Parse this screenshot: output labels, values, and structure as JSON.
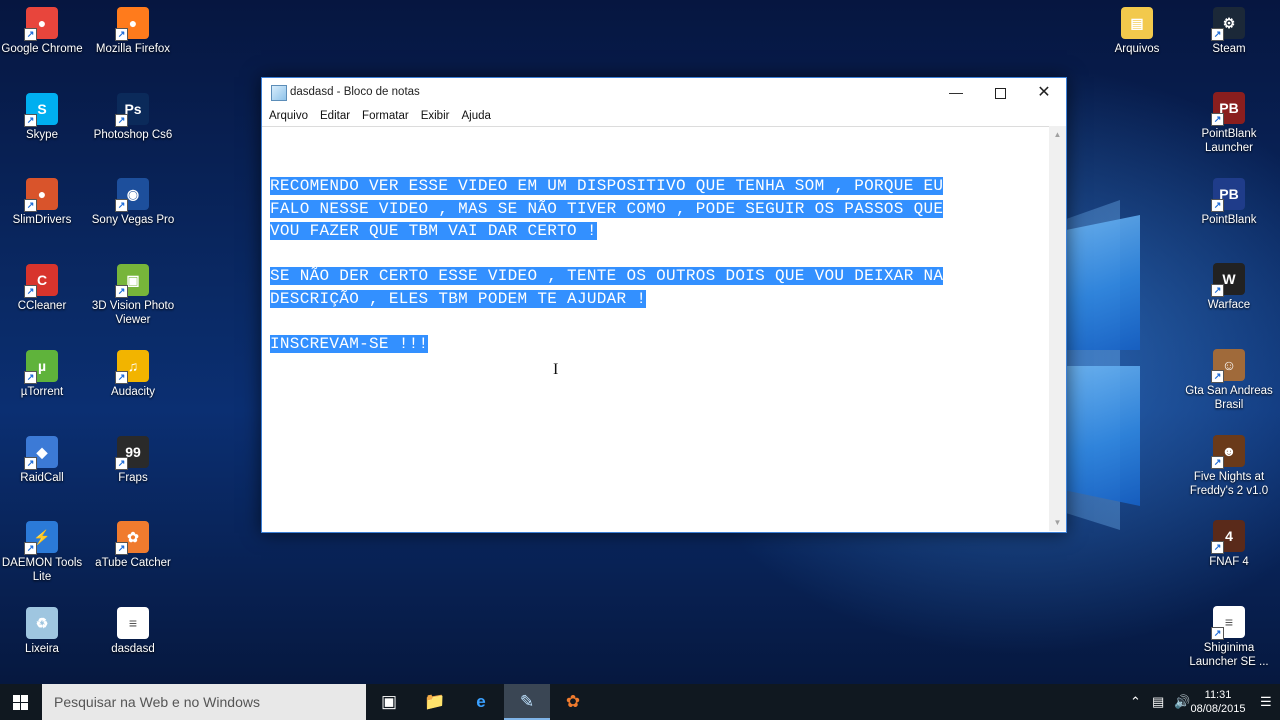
{
  "desktop": {
    "icons_left": [
      {
        "label": "Google Chrome",
        "icon": "chrome-icon"
      },
      {
        "label": "Mozilla Firefox",
        "icon": "firefox-icon"
      },
      {
        "label": "Skype",
        "icon": "skype-icon"
      },
      {
        "label": "Photoshop Cs6",
        "icon": "photoshop-icon"
      },
      {
        "label": "SlimDrivers",
        "icon": "slimdrivers-icon"
      },
      {
        "label": "Sony Vegas Pro",
        "icon": "vegas-icon"
      },
      {
        "label": "CCleaner",
        "icon": "ccleaner-icon"
      },
      {
        "label": "3D Vision Photo Viewer",
        "icon": "3dvision-icon"
      },
      {
        "label": "µTorrent",
        "icon": "utorrent-icon"
      },
      {
        "label": "Audacity",
        "icon": "audacity-icon"
      },
      {
        "label": "RaidCall",
        "icon": "raidcall-icon"
      },
      {
        "label": "Fraps",
        "icon": "fraps-icon"
      },
      {
        "label": "DAEMON Tools Lite",
        "icon": "daemon-tools-icon"
      },
      {
        "label": "aTube Catcher",
        "icon": "atube-icon"
      },
      {
        "label": "Lixeira",
        "icon": "recycle-bin-icon"
      },
      {
        "label": "dasdasd",
        "icon": "text-file-icon"
      }
    ],
    "icons_right": [
      {
        "label": "Arquivos",
        "icon": "folder-icon"
      },
      {
        "label": "Steam",
        "icon": "steam-icon"
      },
      {
        "label": "PointBlank Launcher",
        "icon": "pointblank-launcher-icon"
      },
      {
        "label": "PointBlank",
        "icon": "pointblank-icon"
      },
      {
        "label": "Warface",
        "icon": "warface-icon"
      },
      {
        "label": "Gta San Andreas Brasil",
        "icon": "gta-icon"
      },
      {
        "label": "Five Nights at Freddy's 2 v1.0",
        "icon": "fnaf2-icon"
      },
      {
        "label": "FNAF 4",
        "icon": "fnaf4-icon"
      },
      {
        "label": "Shiginima Launcher SE ...",
        "icon": "shiginima-icon"
      }
    ]
  },
  "notepad": {
    "title": "dasdasd - Bloco de notas",
    "menu": [
      "Arquivo",
      "Editar",
      "Formatar",
      "Exibir",
      "Ajuda"
    ],
    "paragraphs": [
      [
        "RECOMENDO VER ESSE VIDEO EM UM DISPOSITIVO QUE TENHA SOM , PORQUE EU",
        "FALO NESSE VIDEO , MAS SE NÃO TIVER COMO , PODE SEGUIR OS PASSOS QUE",
        "VOU FAZER QUE TBM VAI DAR CERTO !"
      ],
      [
        "SE NÃO DER CERTO ESSE VIDEO , TENTE OS OUTROS DOIS QUE VOU DEIXAR NA",
        "DESCRIÇÃO , ELES TBM PODEM TE AJUDAR !"
      ],
      [
        "INSCREVAM-SE !!!"
      ]
    ],
    "selection_color": "#3390ff"
  },
  "taskbar": {
    "search_placeholder": "Pesquisar na Web e no Windows",
    "time": "11:31",
    "date": "08/08/2015",
    "pinned": [
      {
        "icon": "task-view-icon"
      },
      {
        "icon": "file-explorer-icon"
      },
      {
        "icon": "edge-icon"
      },
      {
        "icon": "notepad-icon",
        "active": true
      },
      {
        "icon": "atube-catcher-icon"
      }
    ]
  }
}
